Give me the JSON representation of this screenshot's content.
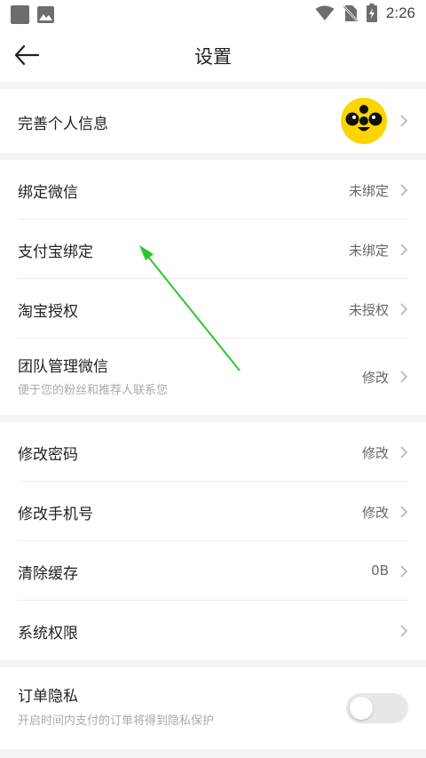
{
  "status_bar": {
    "time": "2:26"
  },
  "nav": {
    "title": "设置"
  },
  "profile": {
    "label": "完善个人信息"
  },
  "group1": [
    {
      "label": "绑定微信",
      "value": "未绑定"
    },
    {
      "label": "支付宝绑定",
      "value": "未绑定"
    },
    {
      "label": "淘宝授权",
      "value": "未授权"
    },
    {
      "label": "团队管理微信",
      "sub": "便于您的粉丝和推荐人联系您",
      "value": "修改"
    }
  ],
  "group2": [
    {
      "label": "修改密码",
      "value": "修改"
    },
    {
      "label": "修改手机号",
      "value": "修改"
    },
    {
      "label": "清除缓存",
      "value": "0B"
    },
    {
      "label": "系统权限",
      "value": ""
    }
  ],
  "order_privacy": {
    "label": "订单隐私",
    "sub": "开启时间内支付的订单将得到隐私保护",
    "enabled": false
  },
  "colors": {
    "annotation_arrow": "#2ec52e",
    "avatar_bg": "#fcd400"
  },
  "icons": [
    "back-arrow-icon",
    "chevron-right-icon",
    "wifi-icon",
    "no-sim-icon",
    "battery-charging-icon",
    "image-icon"
  ]
}
